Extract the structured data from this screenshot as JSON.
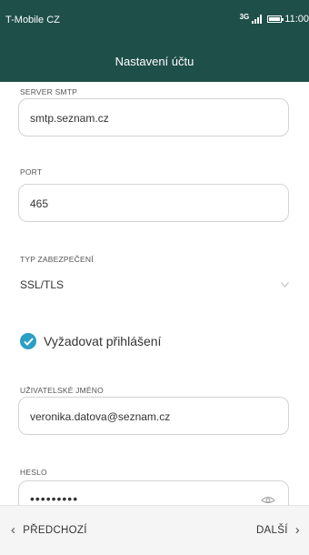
{
  "status_bar": {
    "carrier": "T-Mobile CZ",
    "network": "3G",
    "time": "11:00"
  },
  "app_bar": {
    "title": "Nastavení účtu"
  },
  "form": {
    "smtp_server": {
      "label": "SERVER SMTP",
      "value": "smtp.seznam.cz"
    },
    "port": {
      "label": "PORT",
      "value": "465"
    },
    "security_type": {
      "label": "TYP ZABEZPEČENÍ",
      "value": "SSL/TLS"
    },
    "require_login": {
      "label": "Vyžadovat přihlášení",
      "checked": true
    },
    "username": {
      "label": "UŽIVATELSKÉ JMÉNO",
      "value": "veronika.datova@seznam.cz"
    },
    "password": {
      "label": "HESLO",
      "value": "•••••••••"
    }
  },
  "bottom_nav": {
    "prev_label": "PŘEDCHOZÍ",
    "next_label": "DALŠÍ",
    "prev_icon": "chevron-left-icon",
    "next_icon": "chevron-right-icon"
  },
  "colors": {
    "header": "#1f4f49",
    "accent": "#2a9fc4"
  }
}
